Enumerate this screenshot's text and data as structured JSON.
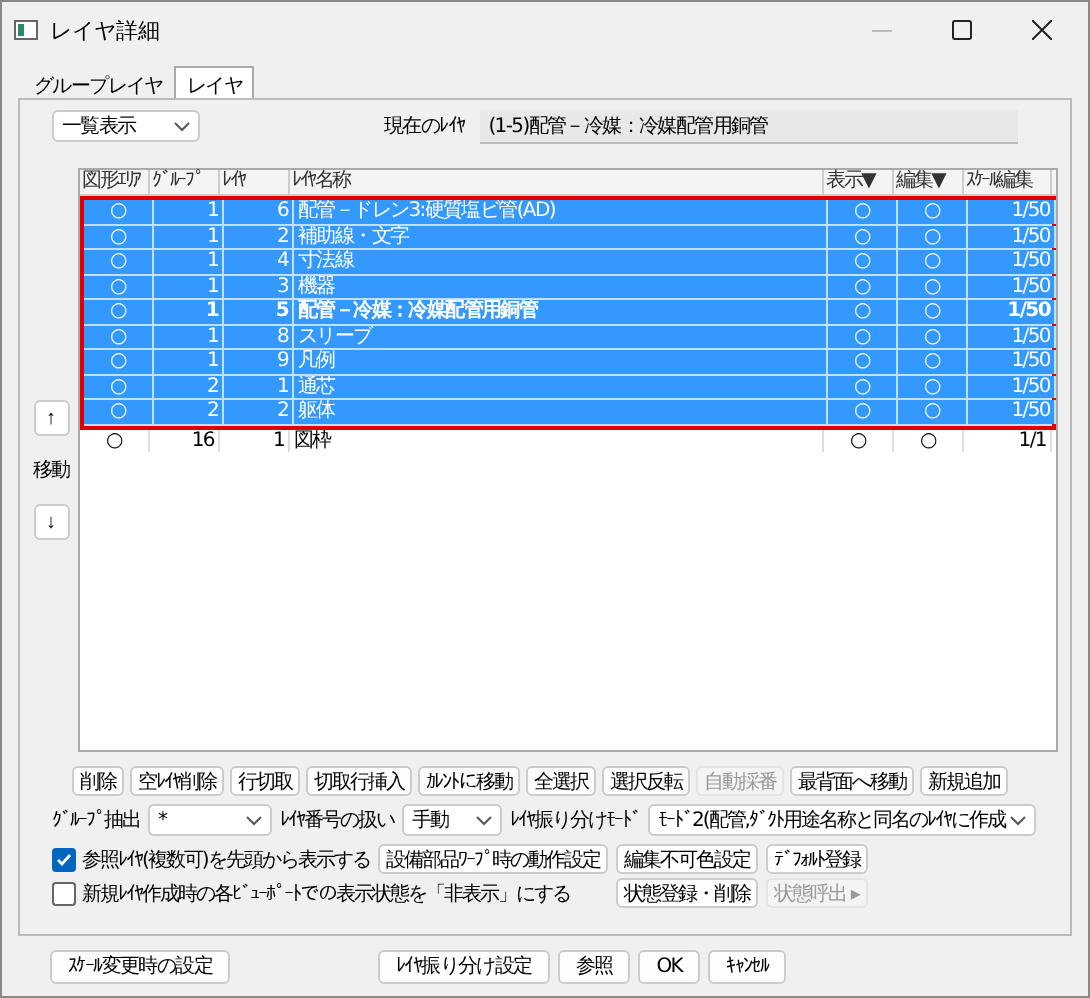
{
  "window": {
    "title": "レイヤ詳細"
  },
  "tabs": [
    {
      "label": "グループレイヤ",
      "selected": false
    },
    {
      "label": "レイヤ",
      "selected": true
    }
  ],
  "view_select": {
    "value": "一覧表示"
  },
  "current_layer": {
    "label": "現在のﾚｲﾔ",
    "value": "(1-5)配管－冷媒：冷媒配管用銅管"
  },
  "move": {
    "up": "↑",
    "label": "移動",
    "down": "↓"
  },
  "table": {
    "columns": [
      "図形ｴﾘｱ",
      "ｸﾞﾙｰﾌﾟ",
      "ﾚｲﾔ",
      "ﾚｲﾔ名称",
      "表示▼",
      "編集▼",
      "ｽｹｰﾙ編集"
    ],
    "rows": [
      {
        "cells": [
          "○",
          "1",
          "6",
          "配管－ドレン3:硬質塩ビ管(AD)",
          "○",
          "○",
          "1/50"
        ],
        "selected": true,
        "current": false
      },
      {
        "cells": [
          "○",
          "1",
          "2",
          "補助線・文字",
          "○",
          "○",
          "1/50"
        ],
        "selected": true,
        "current": false
      },
      {
        "cells": [
          "○",
          "1",
          "4",
          "寸法線",
          "○",
          "○",
          "1/50"
        ],
        "selected": true,
        "current": false
      },
      {
        "cells": [
          "○",
          "1",
          "3",
          "機器",
          "○",
          "○",
          "1/50"
        ],
        "selected": true,
        "current": false
      },
      {
        "cells": [
          "○",
          "1",
          "5",
          "配管－冷媒：冷媒配管用銅管",
          "○",
          "○",
          "1/50"
        ],
        "selected": true,
        "current": true
      },
      {
        "cells": [
          "○",
          "1",
          "8",
          "スリーブ",
          "○",
          "○",
          "1/50"
        ],
        "selected": true,
        "current": false
      },
      {
        "cells": [
          "○",
          "1",
          "9",
          "凡例",
          "○",
          "○",
          "1/50"
        ],
        "selected": true,
        "current": false
      },
      {
        "cells": [
          "○",
          "2",
          "1",
          "通芯",
          "○",
          "○",
          "1/50"
        ],
        "selected": true,
        "current": false
      },
      {
        "cells": [
          "○",
          "2",
          "2",
          "躯体",
          "○",
          "○",
          "1/50"
        ],
        "selected": true,
        "current": false
      },
      {
        "cells": [
          "○",
          "16",
          "1",
          "図枠",
          "○",
          "○",
          "1/1"
        ],
        "selected": false,
        "current": false
      }
    ]
  },
  "action_buttons": [
    {
      "label": "削除",
      "disabled": false
    },
    {
      "label": "空ﾚｲﾔ削除",
      "disabled": false
    },
    {
      "label": "行切取",
      "disabled": false
    },
    {
      "label": "切取行挿入",
      "disabled": false
    },
    {
      "label": "ｶﾚﾝﾄに移動",
      "disabled": false
    },
    {
      "label": "全選択",
      "disabled": false
    },
    {
      "label": "選択反転",
      "disabled": false
    },
    {
      "label": "自動採番",
      "disabled": true
    },
    {
      "label": "最背面へ移動",
      "disabled": false
    },
    {
      "label": "新規追加",
      "disabled": false
    }
  ],
  "options": [
    {
      "label": "ｸﾞﾙｰﾌﾟ抽出",
      "value": "*"
    },
    {
      "label": "ﾚｲﾔ番号の扱い",
      "value": "手動"
    },
    {
      "label": "ﾚｲﾔ振り分けﾓｰﾄﾞ",
      "value": "ﾓｰﾄﾞ2(配管,ﾀﾞｸﾄ用途名称と同名のﾚｲﾔに作成"
    }
  ],
  "checkboxes": [
    {
      "label": "参照ﾚｲﾔ(複数可)を先頭から表示する",
      "checked": true
    },
    {
      "label": "新規ﾚｲﾔ作成時の各ﾋﾞｭｰﾎﾟｰﾄでの表示状態を「非表示」にする",
      "checked": false
    }
  ],
  "setting_buttons": [
    {
      "label": "設備部品ﾜｰﾌﾟ時の動作設定",
      "disabled": false
    },
    {
      "label": "編集不可色設定",
      "disabled": false
    },
    {
      "label": "ﾃﾞﾌｫﾙﾄ登録",
      "disabled": false
    },
    {
      "label": "状態登録・削除",
      "disabled": false
    },
    {
      "label": "状態呼出 ▸",
      "disabled": true
    }
  ],
  "footer_buttons": [
    "ｽｹｰﾙ変更時の設定",
    "ﾚｲﾔ振り分け設定",
    "参照",
    "OK",
    "ｷｬﾝｾﾙ"
  ]
}
